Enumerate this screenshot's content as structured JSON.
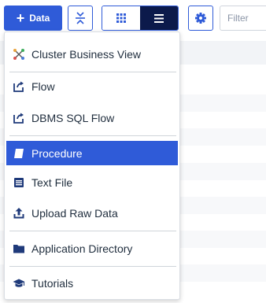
{
  "toolbar": {
    "data_button_label": "Data",
    "filter_placeholder": "Filter"
  },
  "menu": {
    "items": [
      {
        "label": "Cluster Business View",
        "icon": "cluster-icon"
      },
      {
        "label": "Flow",
        "icon": "flow-icon"
      },
      {
        "label": "DBMS SQL Flow",
        "icon": "dbms-flow-icon"
      },
      {
        "label": "Procedure",
        "icon": "procedure-icon",
        "selected": true
      },
      {
        "label": "Text File",
        "icon": "text-file-icon"
      },
      {
        "label": "Upload Raw Data",
        "icon": "upload-icon"
      },
      {
        "label": "Application Directory",
        "icon": "folder-icon"
      },
      {
        "label": "Tutorials",
        "icon": "graduation-cap-icon"
      }
    ]
  },
  "colors": {
    "accent": "#2f5bd8",
    "active_view": "#0c1a4b",
    "icon_dark": "#1f3a7a"
  }
}
